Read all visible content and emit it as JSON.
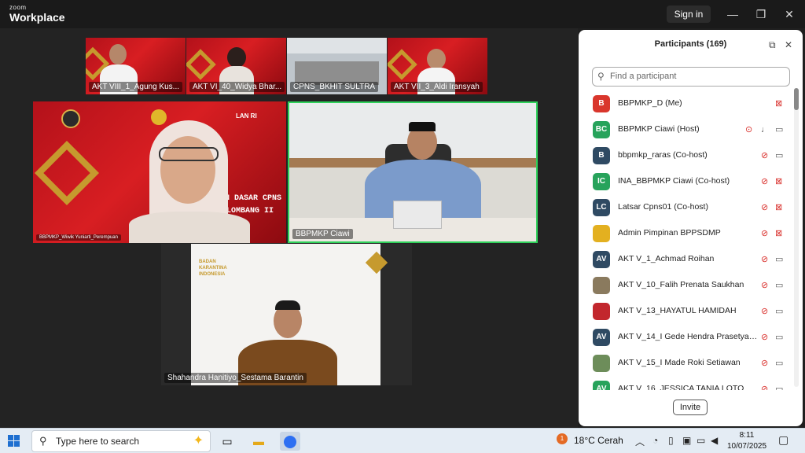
{
  "app": {
    "brand_small": "zoom",
    "brand_big": "Workplace",
    "signin": "Sign in"
  },
  "window_controls": {
    "minimize": "—",
    "maximize": "❐",
    "close": "✕"
  },
  "gallery": {
    "top_row": [
      {
        "name": "AKT VIII_1_Agung Kus..."
      },
      {
        "name": "AKT VI_40_Widya Bhar..."
      },
      {
        "name": "CPNS_BKHIT SULTRA"
      },
      {
        "name": "AKT VII_3_Aldi Iransyah"
      }
    ],
    "tile_left": {
      "name": "BBPMKP_Wiwik Yuniarti_Perempuan",
      "banner_line1": "AN DASAR CPNS",
      "banner_line2": "ELOMBANG II",
      "logo_text": "LAN RI"
    },
    "tile_right": {
      "name": "BBPMKP Ciawi"
    },
    "tile_bottom": {
      "name": "Shahandra Hanitiyo_Sestama Barantin",
      "banner_line1": "BADAN",
      "banner_line2": "KARANTINA",
      "banner_line3": "INDONESIA"
    }
  },
  "participants": {
    "title": "Participants (169)",
    "search_placeholder": "Find a participant",
    "invite": "Invite",
    "list": [
      {
        "initials": "B",
        "name": "BBPMKP_D (Me)",
        "color": "#d9362c",
        "mic": "none",
        "video": "off"
      },
      {
        "initials": "BC",
        "name": "BBPMKP Ciawi (Host)",
        "color": "#27a35b",
        "mic": "on",
        "video": "on"
      },
      {
        "initials": "B",
        "name": "bbpmkp_raras (Co-host)",
        "color": "#2f4a63",
        "mic": "off",
        "video": "on"
      },
      {
        "initials": "IC",
        "name": "INA_BBPMKP Ciawi (Co-host)",
        "color": "#27a35b",
        "mic": "off",
        "video": "off"
      },
      {
        "initials": "LC",
        "name": "Latsar Cpns01 (Co-host)",
        "color": "#2f4a63",
        "mic": "off",
        "video": "off"
      },
      {
        "initials": "",
        "name": "Admin Pimpinan BPPSDMP",
        "color": "#e3b020",
        "mic": "off",
        "video": "off"
      },
      {
        "initials": "AV",
        "name": "AKT V_1_Achmad Roihan",
        "color": "#2f4a63",
        "mic": "off",
        "video": "on"
      },
      {
        "initials": "",
        "name": "AKT V_10_Falih Prenata Saukhan",
        "color": "#8a7a5e",
        "mic": "off",
        "video": "on"
      },
      {
        "initials": "",
        "name": "AKT V_13_HAYATUL HAMIDAH",
        "color": "#c2272d",
        "mic": "off",
        "video": "on"
      },
      {
        "initials": "AV",
        "name": "AKT V_14_I Gede Hendra Prasetya W...",
        "color": "#2f4a63",
        "mic": "off",
        "video": "on"
      },
      {
        "initials": "",
        "name": "AKT V_15_I Made Roki Setiawan",
        "color": "#6d8d5a",
        "mic": "off",
        "video": "on"
      },
      {
        "initials": "AV",
        "name": "AKT V_16_JESSICA TANIA LOTO",
        "color": "#27a35b",
        "mic": "off",
        "video": "on"
      }
    ]
  },
  "taskbar": {
    "search_text": "Type here to search",
    "weather": "18°C  Cerah",
    "notification_count": "1",
    "time": "8:11",
    "date": "10/07/2025"
  }
}
